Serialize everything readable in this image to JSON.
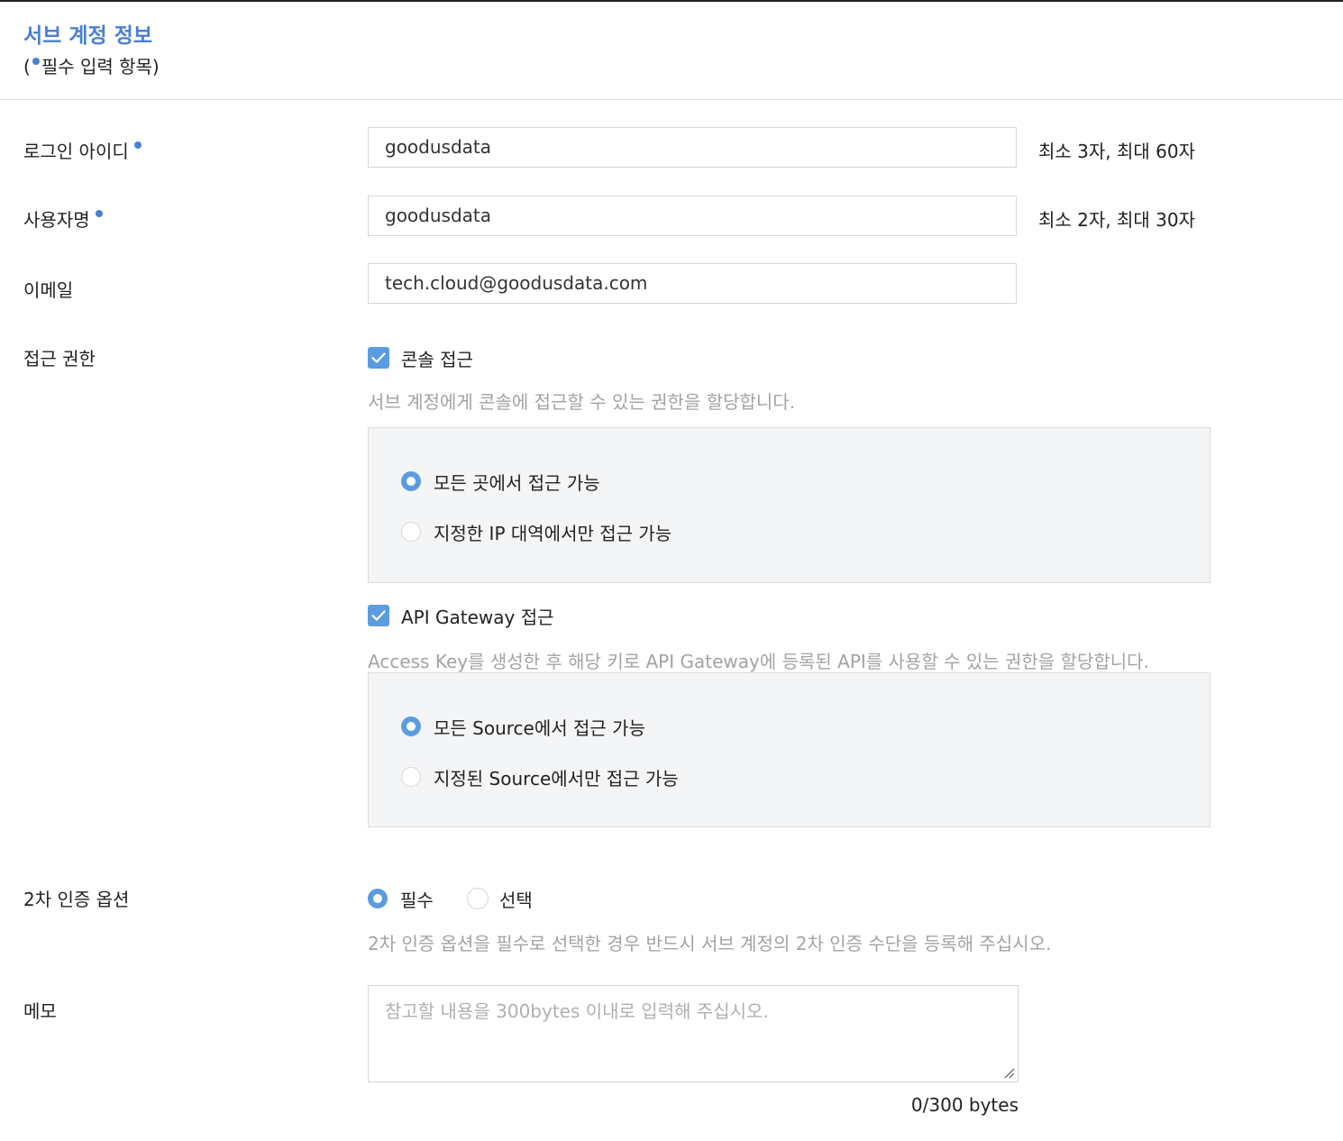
{
  "header": {
    "title": "서브 계정 정보",
    "subtitle_open": "(",
    "subtitle_text": "필수 입력 항목)"
  },
  "login_id": {
    "label": "로그인 아이디",
    "value": "goodusdata",
    "hint": "최소 3자, 최대 60자"
  },
  "username": {
    "label": "사용자명",
    "value": "goodusdata",
    "hint": "최소 2자, 최대 30자"
  },
  "email": {
    "label": "이메일",
    "value": "tech.cloud@goodusdata.com"
  },
  "access": {
    "label": "접근 권한",
    "console": {
      "label": "콘솔 접근",
      "checked": true,
      "description": "서브 계정에게 콘솔에 접근할 수 있는 권한을 할당합니다.",
      "options": [
        {
          "label": "모든 곳에서 접근 가능",
          "selected": true
        },
        {
          "label": "지정한 IP 대역에서만 접근 가능",
          "selected": false
        }
      ]
    },
    "api_gateway": {
      "label": "API Gateway 접근",
      "checked": true,
      "description": "Access Key를 생성한 후 해당 키로 API Gateway에 등록된 API를 사용할 수 있는 권한을 할당합니다.",
      "options": [
        {
          "label": "모든 Source에서 접근 가능",
          "selected": true
        },
        {
          "label": "지정된 Source에서만 접근 가능",
          "selected": false
        }
      ]
    }
  },
  "two_factor": {
    "label": "2차 인증 옵션",
    "options": [
      {
        "label": "필수",
        "selected": true
      },
      {
        "label": "선택",
        "selected": false
      }
    ],
    "description": "2차 인증 옵션을 필수로 선택한 경우 반드시 서브 계정의 2차 인증 수단을 등록해 주십시오."
  },
  "memo": {
    "label": "메모",
    "placeholder": "참고할 내용을 300bytes 이내로 입력해 주십시오.",
    "byte_count": "0/300 bytes"
  },
  "colors": {
    "accent": "#4a7fd1",
    "checkbox": "#5b9ce0",
    "panel_bg": "#f4f5f7"
  }
}
